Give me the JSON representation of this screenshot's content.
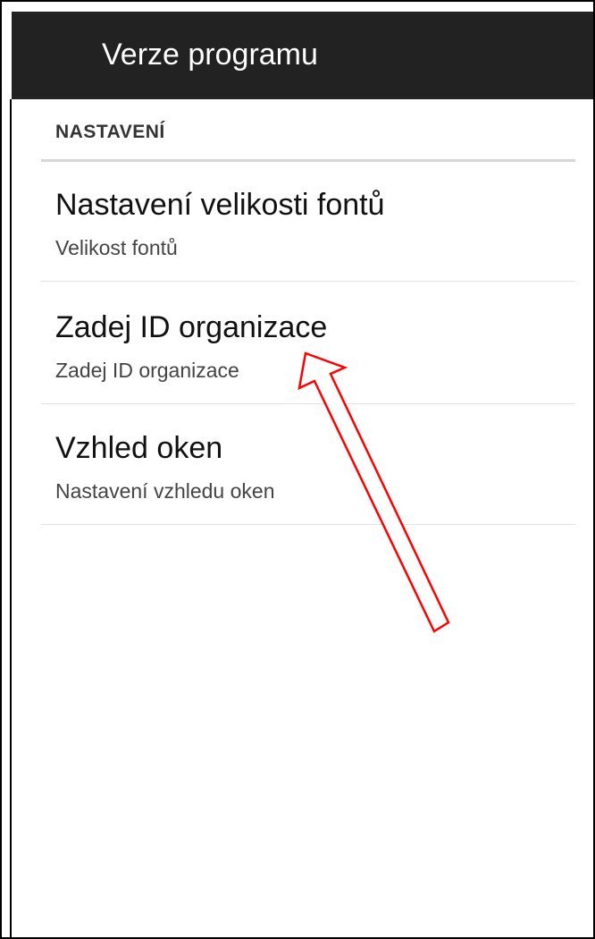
{
  "action_bar": {
    "title": "Verze programu"
  },
  "section": {
    "header": "NASTAVENÍ"
  },
  "preferences": [
    {
      "title": "Nastavení velikosti fontů",
      "summary": "Velikost fontů"
    },
    {
      "title": "Zadej ID organizace",
      "summary": "Zadej ID organizace"
    },
    {
      "title": "Vzhled oken",
      "summary": "Nastavení vzhledu oken"
    }
  ],
  "annotation": {
    "shape": "arrow",
    "stroke_color": "#ff0000",
    "fill_color": "#ffffff"
  }
}
